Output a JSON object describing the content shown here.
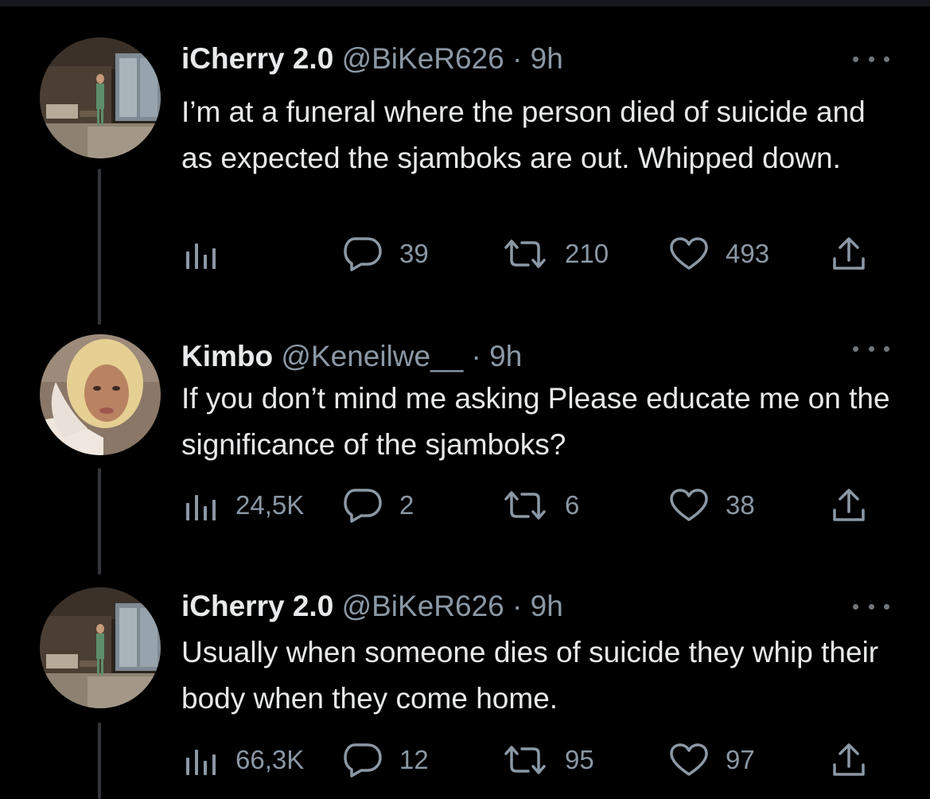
{
  "colors": {
    "background": "#000000",
    "text_primary": "#e7e9ea",
    "text_secondary": "#8b98a5",
    "thread_line": "#333639"
  },
  "tweets": [
    {
      "name": "iCherry 2.0",
      "handle": "@BiKeR626",
      "dot": "·",
      "time": "9h",
      "text": "I’m at a funeral where the person died of suicide and as expected the sjamboks are out. Whipped down.",
      "views": "",
      "replies": "39",
      "retweets": "210",
      "likes": "493",
      "icons": [
        "views-icon",
        "reply-icon",
        "retweet-icon",
        "like-icon",
        "share-icon",
        "more-icon"
      ]
    },
    {
      "name": "Kimbo",
      "handle": "@Keneilwe__",
      "dot": "·",
      "time": "9h",
      "text": "If you don’t mind me asking Please educate me on the significance of the sjamboks?",
      "views": "24,5K",
      "replies": "2",
      "retweets": "6",
      "likes": "38",
      "icons": [
        "views-icon",
        "reply-icon",
        "retweet-icon",
        "like-icon",
        "share-icon",
        "more-icon"
      ]
    },
    {
      "name": "iCherry 2.0",
      "handle": "@BiKeR626",
      "dot": "·",
      "time": "9h",
      "text": "Usually when someone dies of suicide they whip their body when they come home.",
      "views": "66,3K",
      "replies": "12",
      "retweets": "95",
      "likes": "97",
      "icons": [
        "views-icon",
        "reply-icon",
        "retweet-icon",
        "like-icon",
        "share-icon",
        "more-icon"
      ]
    }
  ]
}
